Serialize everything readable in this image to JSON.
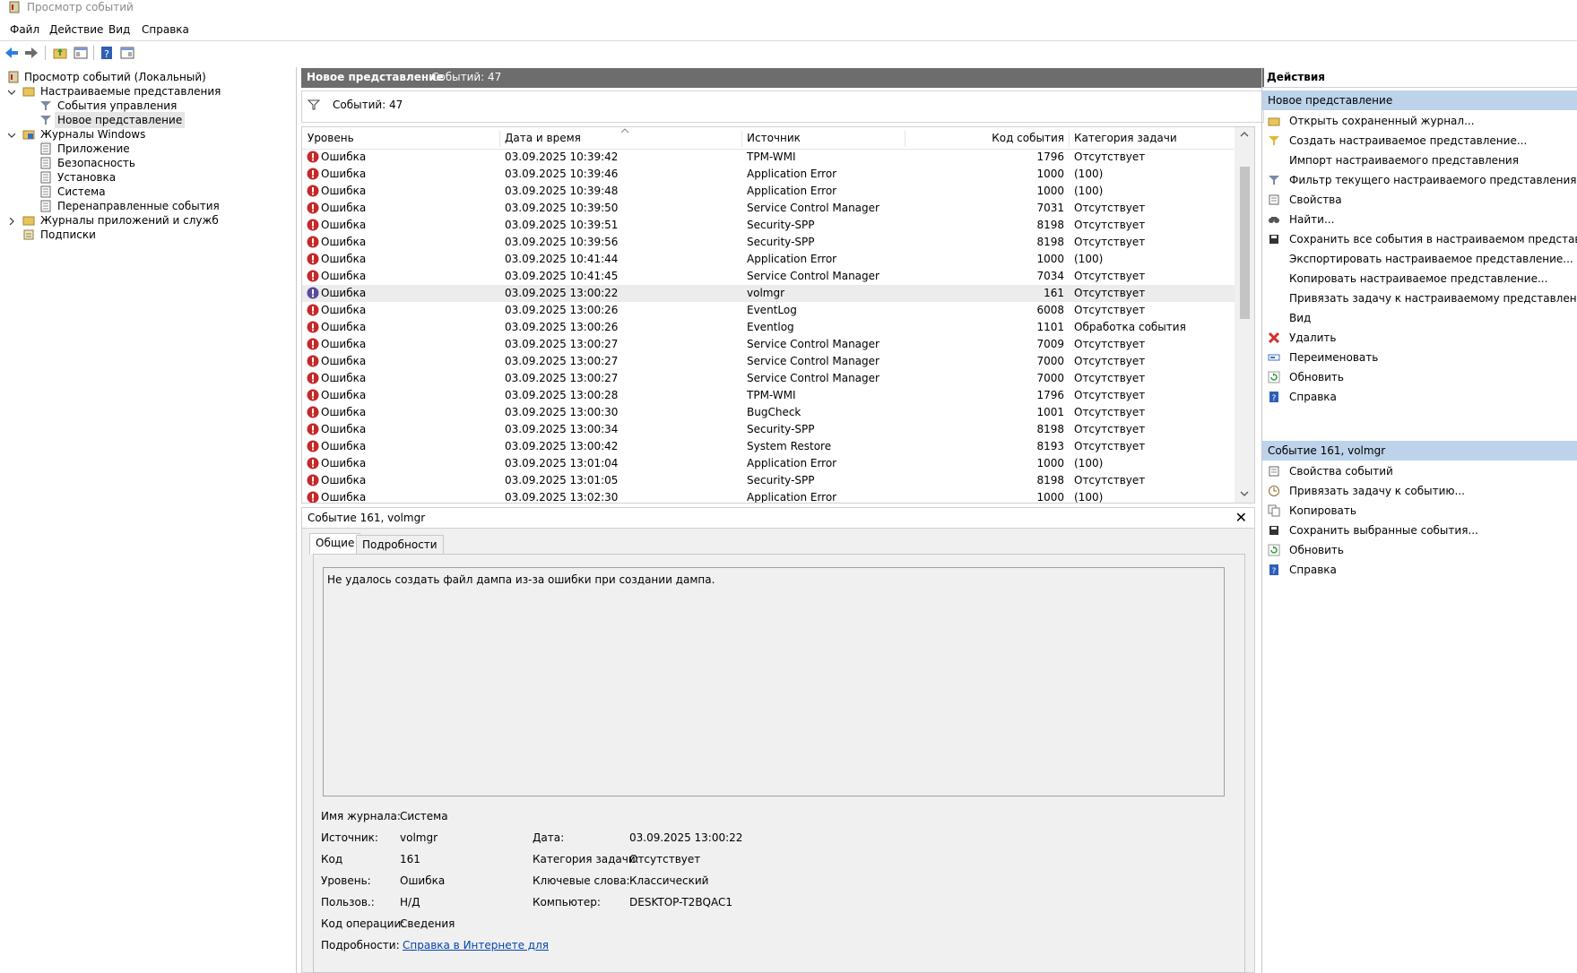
{
  "window": {
    "title": "Просмотр событий"
  },
  "menu": [
    "Файл",
    "Действие",
    "Вид",
    "Справка"
  ],
  "tree": {
    "root": "Просмотр событий (Локальный)",
    "custom_views": "Настраиваемые представления",
    "admin_events": "События управления",
    "new_view": "Новое представление",
    "windows_logs": "Журналы Windows",
    "application": "Приложение",
    "security": "Безопасность",
    "setup": "Установка",
    "system": "Система",
    "forwarded": "Перенаправленные события",
    "app_services_logs": "Журналы приложений и служб",
    "subscriptions": "Подписки"
  },
  "center": {
    "header_title": "Новое представление",
    "header_count": "Событий: 47",
    "filter_count": "Событий: 47"
  },
  "grid": {
    "columns": [
      "Уровень",
      "Дата и время",
      "Источник",
      "Код события",
      "Категория задачи"
    ],
    "rows": [
      [
        "Ошибка",
        "03.09.2025 10:39:42",
        "TPM-WMI",
        "1796",
        "Отсутствует"
      ],
      [
        "Ошибка",
        "03.09.2025 10:39:46",
        "Application Error",
        "1000",
        "(100)"
      ],
      [
        "Ошибка",
        "03.09.2025 10:39:48",
        "Application Error",
        "1000",
        "(100)"
      ],
      [
        "Ошибка",
        "03.09.2025 10:39:50",
        "Service Control Manager",
        "7031",
        "Отсутствует"
      ],
      [
        "Ошибка",
        "03.09.2025 10:39:51",
        "Security-SPP",
        "8198",
        "Отсутствует"
      ],
      [
        "Ошибка",
        "03.09.2025 10:39:56",
        "Security-SPP",
        "8198",
        "Отсутствует"
      ],
      [
        "Ошибка",
        "03.09.2025 10:41:44",
        "Application Error",
        "1000",
        "(100)"
      ],
      [
        "Ошибка",
        "03.09.2025 10:41:45",
        "Service Control Manager",
        "7034",
        "Отсутствует"
      ],
      [
        "Ошибка",
        "03.09.2025 13:00:22",
        "volmgr",
        "161",
        "Отсутствует"
      ],
      [
        "Ошибка",
        "03.09.2025 13:00:26",
        "EventLog",
        "6008",
        "Отсутствует"
      ],
      [
        "Ошибка",
        "03.09.2025 13:00:26",
        "Eventlog",
        "1101",
        "Обработка события"
      ],
      [
        "Ошибка",
        "03.09.2025 13:00:27",
        "Service Control Manager",
        "7009",
        "Отсутствует"
      ],
      [
        "Ошибка",
        "03.09.2025 13:00:27",
        "Service Control Manager",
        "7000",
        "Отсутствует"
      ],
      [
        "Ошибка",
        "03.09.2025 13:00:27",
        "Service Control Manager",
        "7000",
        "Отсутствует"
      ],
      [
        "Ошибка",
        "03.09.2025 13:00:28",
        "TPM-WMI",
        "1796",
        "Отсутствует"
      ],
      [
        "Ошибка",
        "03.09.2025 13:00:30",
        "BugCheck",
        "1001",
        "Отсутствует"
      ],
      [
        "Ошибка",
        "03.09.2025 13:00:34",
        "Security-SPP",
        "8198",
        "Отсутствует"
      ],
      [
        "Ошибка",
        "03.09.2025 13:00:42",
        "System Restore",
        "8193",
        "Отсутствует"
      ],
      [
        "Ошибка",
        "03.09.2025 13:01:04",
        "Application Error",
        "1000",
        "(100)"
      ],
      [
        "Ошибка",
        "03.09.2025 13:01:05",
        "Security-SPP",
        "8198",
        "Отсутствует"
      ],
      [
        "Ошибка",
        "03.09.2025 13:02:30",
        "Application Error",
        "1000",
        "(100)"
      ]
    ],
    "selected_index": 8
  },
  "detail": {
    "title": "Событие 161, volmgr",
    "tab_general": "Общие",
    "tab_details": "Подробности",
    "message": "Не удалось создать файл дампа из-за ошибки при создании дампа.",
    "log_name_label": "Имя журнала:",
    "log_name": "Система",
    "source_label": "Источник:",
    "source": "volmgr",
    "date_label": "Дата:",
    "date": "03.09.2025 13:00:22",
    "code_label": "Код",
    "code": "161",
    "task_label": "Категория задачи:",
    "task": "Отсутствует",
    "level_label": "Уровень:",
    "level": "Ошибка",
    "keywords_label": "Ключевые слова:",
    "keywords": "Классический",
    "user_label": "Пользов.:",
    "user": "Н/Д",
    "computer_label": "Компьютер:",
    "computer": "DESKTOP-T2BQAC1",
    "opcode_label": "Код операции:",
    "opcode": "Сведения",
    "more_label": "Подробности:",
    "more_link": "Справка в Интернете для"
  },
  "actions": {
    "header": "Действия",
    "section1": "Новое представление",
    "items1": [
      "Открыть сохраненный журнал...",
      "Создать настраиваемое представление...",
      "Импорт настраиваемого представления",
      "Фильтр текущего настраиваемого представления...",
      "Свойства",
      "Найти...",
      "Сохранить все события в настраиваемом представлени",
      "Экспортировать настраиваемое представление...",
      "Копировать настраиваемое представление...",
      "Привязать задачу к настраиваемому представлению...",
      "Вид",
      "Удалить",
      "Переименовать",
      "Обновить",
      "Справка"
    ],
    "section2": "Событие 161, volmgr",
    "items2": [
      "Свойства событий",
      "Привязать задачу к событию...",
      "Копировать",
      "Сохранить выбранные события...",
      "Обновить",
      "Справка"
    ]
  }
}
